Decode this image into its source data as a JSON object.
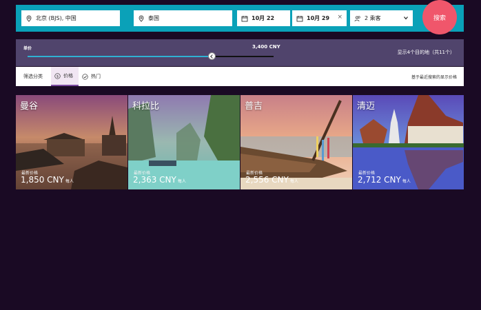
{
  "search": {
    "origin": "北京 (BJS), 中国",
    "destination": "泰国",
    "depart_date": "10月 22",
    "return_date": "10月 29",
    "clear_symbol": "×",
    "passengers": "2 乘客",
    "search_label": "搜索",
    "accent_color": "#0aa1b8",
    "button_color": "#f0566b"
  },
  "price_filter": {
    "label": "单价",
    "value": "3,400 CNY",
    "slider_level": 0.75,
    "result_text": "显示4个目的地（共11个）"
  },
  "filter_bar": {
    "filter_label": "筛选分类",
    "tab_price": "价格",
    "tab_popular": "热门",
    "note": "基于最近搜索的显示价格"
  },
  "destinations": [
    {
      "name": "曼谷",
      "price_label": "最新价格",
      "price": "1,850 CNY",
      "per": "每人"
    },
    {
      "name": "科拉比",
      "price_label": "最新价格",
      "price": "2,363 CNY",
      "per": "每人"
    },
    {
      "name": "普吉",
      "price_label": "最新价格",
      "price": "2,556 CNY",
      "per": "每人"
    },
    {
      "name": "清迈",
      "price_label": "最新价格",
      "price": "2,712 CNY",
      "per": "每人"
    }
  ]
}
